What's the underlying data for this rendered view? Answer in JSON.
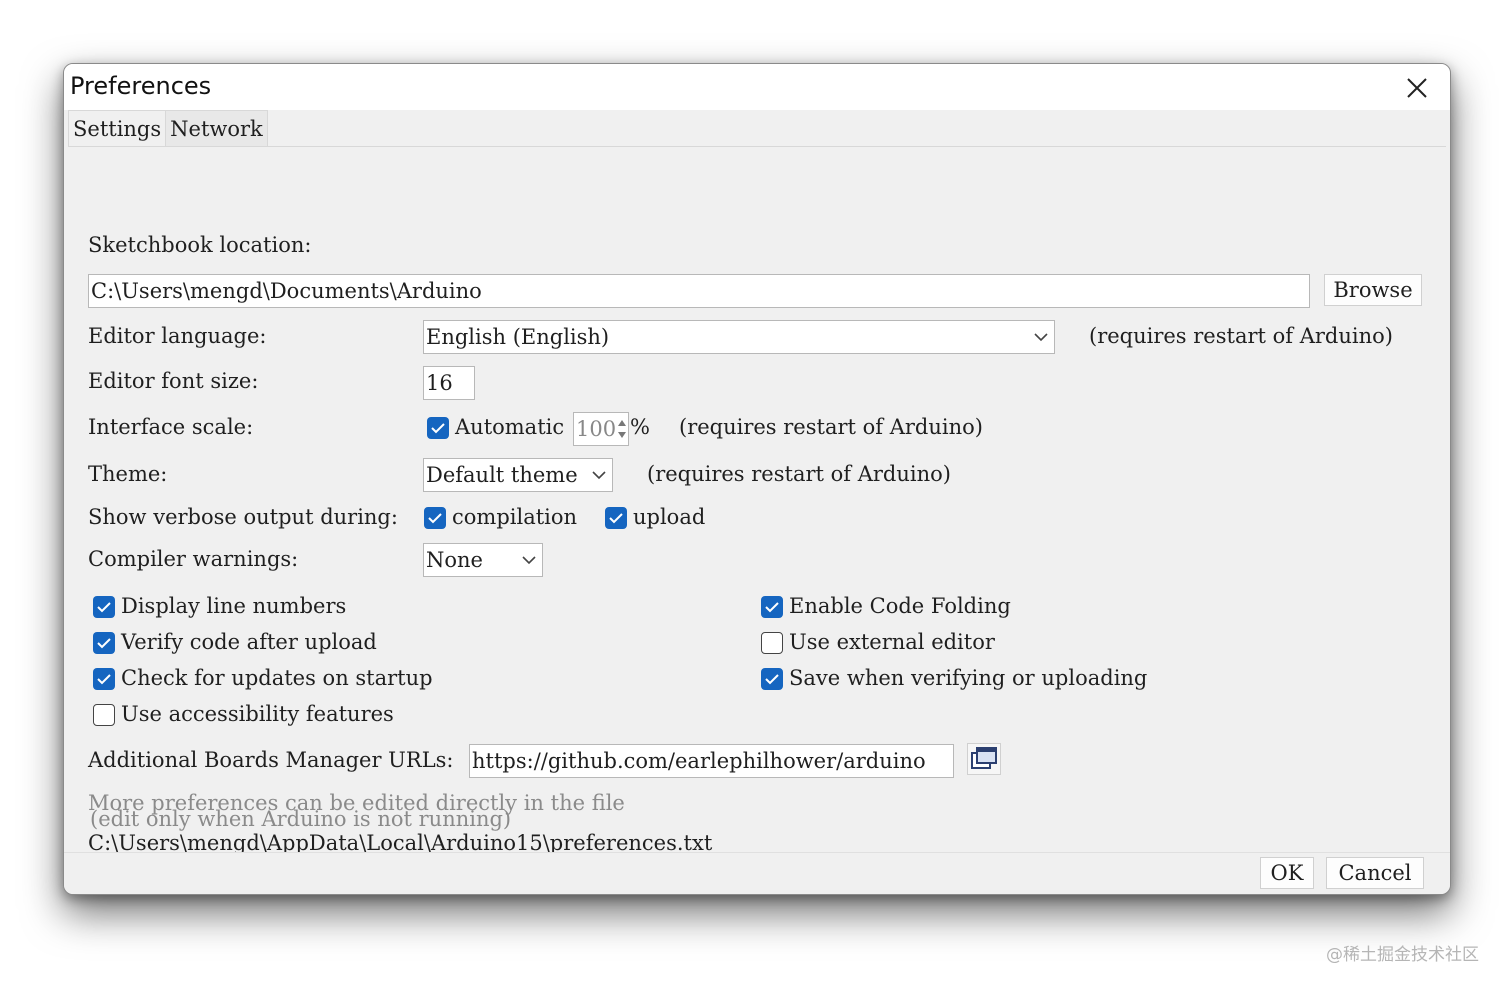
{
  "window": {
    "title": "Preferences"
  },
  "tabs": [
    {
      "label": "Settings"
    },
    {
      "label": "Network"
    }
  ],
  "settings": {
    "sketchbook_label": "Sketchbook location:",
    "sketchbook_path": "C:\\Users\\mengd\\Documents\\Arduino",
    "browse_label": "Browse",
    "editor_language_label": "Editor language:",
    "editor_language_value": "English (English)",
    "editor_language_note": "(requires restart of Arduino)",
    "font_size_label": "Editor font size:",
    "font_size_value": "16",
    "interface_scale_label": "Interface scale:",
    "automatic_label": "Automatic",
    "automatic_checked": true,
    "scale_value": "100",
    "scale_unit": "%",
    "interface_scale_note": "(requires restart of Arduino)",
    "theme_label": "Theme:",
    "theme_value": "Default theme",
    "theme_note": "(requires restart of Arduino)",
    "verbose_label": "Show verbose output during:",
    "verbose_compilation_label": "compilation",
    "verbose_compilation_checked": true,
    "verbose_upload_label": "upload",
    "verbose_upload_checked": true,
    "compiler_warnings_label": "Compiler warnings:",
    "compiler_warnings_value": "None",
    "options": [
      {
        "label": "Display line numbers",
        "checked": true
      },
      {
        "label": "Verify code after upload",
        "checked": true
      },
      {
        "label": "Check for updates on startup",
        "checked": true
      },
      {
        "label": "Use accessibility features",
        "checked": false
      },
      {
        "label": "Enable Code Folding",
        "checked": true
      },
      {
        "label": "Use external editor",
        "checked": false
      },
      {
        "label": "Save when verifying or uploading",
        "checked": true
      }
    ],
    "boards_urls_label": "Additional Boards Manager URLs:",
    "boards_urls_value": "https://github.com/earlephilhower/arduino",
    "more_prefs_note": "More preferences can be edited directly in the file",
    "prefs_file_path": "C:\\Users\\mengd\\AppData\\Local\\Arduino15\\preferences.txt",
    "edit_note": "(edit only when Arduino is not running)"
  },
  "footer": {
    "ok_label": "OK",
    "cancel_label": "Cancel"
  },
  "watermark": "@稀土掘金技术社区",
  "colors": {
    "accent": "#1565c0",
    "dialog_bg": "#f0f0f0",
    "titlebar_bg": "#ffffff"
  }
}
